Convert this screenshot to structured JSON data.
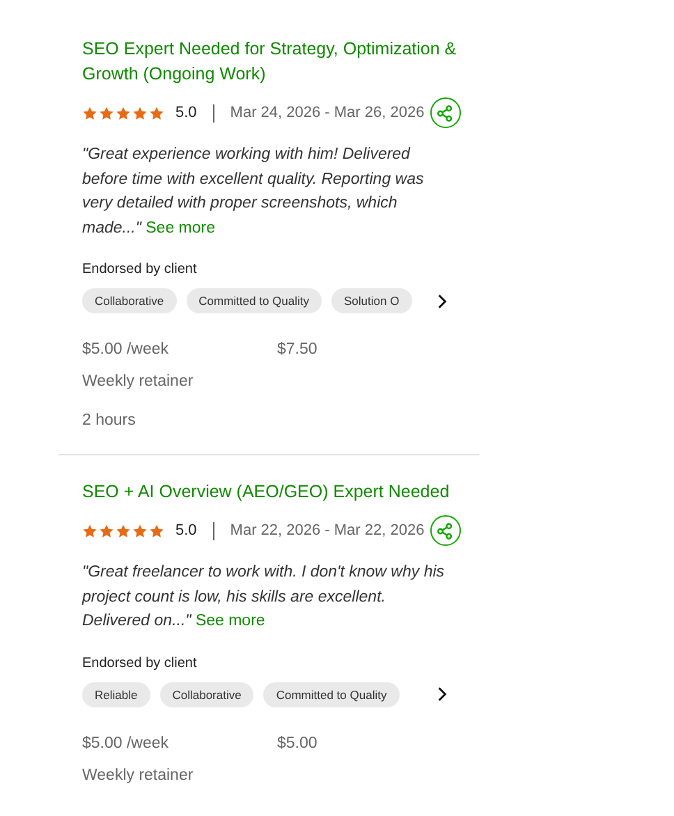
{
  "jobs": [
    {
      "title": "SEO Expert Needed for Strategy, Optimization & Growth (Ongoing Work)",
      "stars": 5,
      "rating": "5.0",
      "dates": "Mar 24, 2026 - Mar 26, 2026",
      "review": "\"Great experience working with him! Delivered before time with excellent quality. Reporting was very detailed with proper screenshots, which made...\"",
      "see_more": "See more",
      "endorsed_label": "Endorsed by client",
      "tags": [
        "Collaborative",
        "Committed to Quality",
        "Solution O"
      ],
      "rate": "$5.00 /week",
      "earned": "$7.50",
      "contract_type": "Weekly retainer",
      "hours": "2 hours"
    },
    {
      "title": "SEO + AI Overview (AEO/GEO) Expert Needed",
      "stars": 5,
      "rating": "5.0",
      "dates": "Mar 22, 2026 - Mar 22, 2026",
      "review": "\"Great freelancer to work with. I don't know why his project count is low, his skills are excellent. Delivered on...\"",
      "see_more": "See more",
      "endorsed_label": "Endorsed by client",
      "tags": [
        "Reliable",
        "Collaborative",
        "Committed to Quality"
      ],
      "rate": "$5.00 /week",
      "earned": "$5.00",
      "contract_type": "Weekly retainer"
    }
  ]
}
